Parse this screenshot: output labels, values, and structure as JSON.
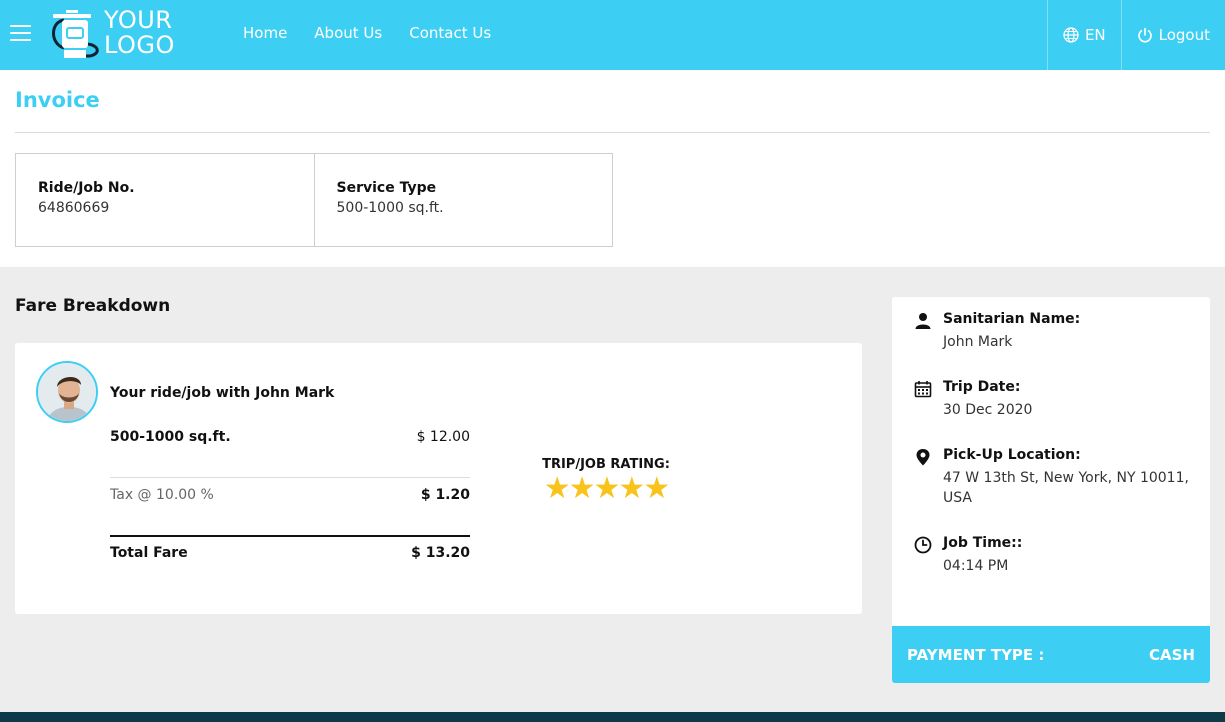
{
  "header": {
    "logo_line1": "YOUR",
    "logo_line2": "LOGO",
    "nav": [
      "Home",
      "About Us",
      "Contact Us"
    ],
    "language": "EN",
    "logout": "Logout",
    "colors": {
      "primary": "#3ccff3",
      "footer": "#0d3a48",
      "star": "#f8c31a"
    }
  },
  "invoice": {
    "title": "Invoice",
    "ride_label": "Ride/Job No.",
    "ride_value": "64860669",
    "service_label": "Service Type",
    "service_value": "500-1000 sq.ft."
  },
  "fare": {
    "title": "Fare Breakdown",
    "ride_with": "Your ride/job with John Mark",
    "service_name": "500-1000 sq.ft.",
    "service_amount": "$ 12.00",
    "tax_label": "Tax @ 10.00 %",
    "tax_amount": "$ 1.20",
    "total_label": "Total Fare",
    "total_amount": "$ 13.20",
    "rating_label": "TRIP/JOB RATING:",
    "rating_stars": 5,
    "stars_text": "★★★★★"
  },
  "side": {
    "name_label": "Sanitarian Name:",
    "name_value": "John Mark",
    "date_label": "Trip Date:",
    "date_value": "30 Dec 2020",
    "pickup_label": "Pick-Up Location:",
    "pickup_value": "47 W 13th St, New York, NY 10011, USA",
    "time_label": "Job Time::",
    "time_value": "04:14 PM",
    "payment_label": "PAYMENT TYPE :",
    "payment_value": "CASH"
  },
  "icons": [
    "menu-icon",
    "globe-icon",
    "power-icon",
    "user-icon",
    "calendar-icon",
    "map-pin-icon",
    "clock-icon",
    "star-icon"
  ]
}
